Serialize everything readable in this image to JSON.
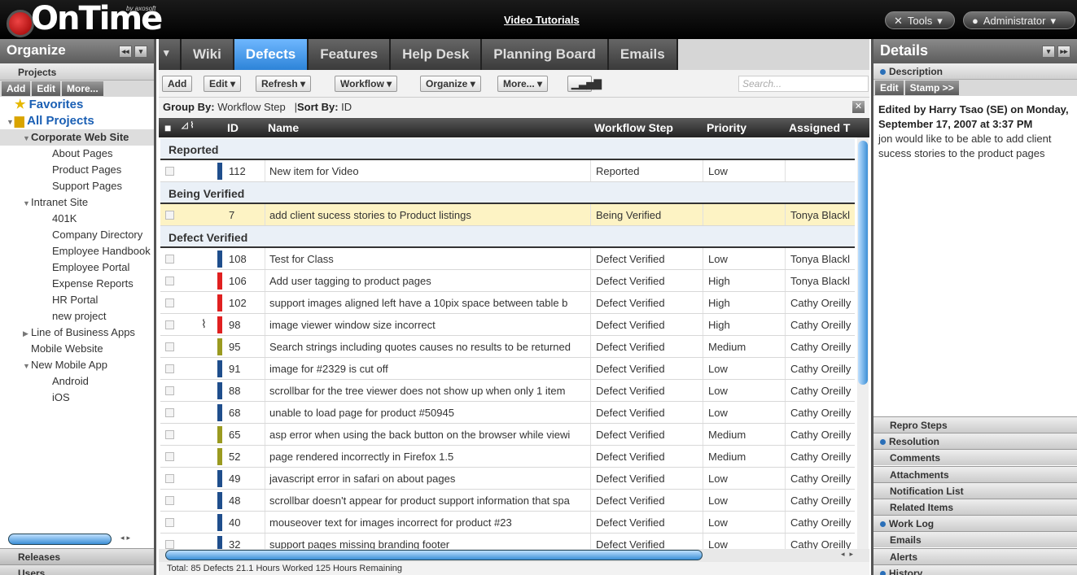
{
  "app": {
    "logo_by": "by axosoft",
    "logo_word": "OnTime",
    "video_link": "Video Tutorials",
    "tools_label": "Tools",
    "admin_label": "Administrator"
  },
  "left": {
    "title": "Organize",
    "projects_label": "Projects",
    "mini_buttons": [
      "Add",
      "Edit",
      "More..."
    ],
    "favorites": "Favorites",
    "all_projects": "All Projects",
    "tree": [
      {
        "label": "Corporate Web Site",
        "level": 1,
        "arrow": "▼"
      },
      {
        "label": "About Pages",
        "level": 2,
        "arrow": ""
      },
      {
        "label": "Product Pages",
        "level": 2,
        "arrow": ""
      },
      {
        "label": "Support Pages",
        "level": 2,
        "arrow": ""
      },
      {
        "label": "Intranet Site",
        "level": 1,
        "arrow": "▼"
      },
      {
        "label": "401K",
        "level": 2,
        "arrow": ""
      },
      {
        "label": "Company Directory",
        "level": 2,
        "arrow": ""
      },
      {
        "label": "Employee Handbook",
        "level": 2,
        "arrow": ""
      },
      {
        "label": "Employee Portal",
        "level": 2,
        "arrow": ""
      },
      {
        "label": "Expense Reports",
        "level": 2,
        "arrow": ""
      },
      {
        "label": "HR Portal",
        "level": 2,
        "arrow": ""
      },
      {
        "label": "new project",
        "level": 2,
        "arrow": ""
      },
      {
        "label": "Line of Business Apps",
        "level": 1,
        "arrow": "▶"
      },
      {
        "label": "Mobile Website",
        "level": 1,
        "arrow": ""
      },
      {
        "label": "New Mobile App",
        "level": 1,
        "arrow": "▼"
      },
      {
        "label": "Android",
        "level": 2,
        "arrow": ""
      },
      {
        "label": "iOS",
        "level": 2,
        "arrow": ""
      }
    ],
    "footer": [
      "Releases",
      "Users"
    ]
  },
  "tabs": [
    "Wiki",
    "Defects",
    "Features",
    "Help Desk",
    "Planning Board",
    "Emails"
  ],
  "toolbar": {
    "add": "Add",
    "edit": "Edit",
    "refresh": "Refresh",
    "workflow": "Workflow",
    "organize": "Organize",
    "more": "More...",
    "search_placeholder": "Search..."
  },
  "groupbar": {
    "group_label": "Group By:",
    "group_value": "Workflow Step",
    "sort_label": "Sort By:",
    "sort_value": "ID"
  },
  "grid": {
    "headers": {
      "id": "ID",
      "name": "Name",
      "workflow": "Workflow Step",
      "priority": "Priority",
      "assigned": "Assigned T"
    },
    "groups": [
      {
        "label": "Reported",
        "rows": [
          {
            "id": "112",
            "name": "New item for Video",
            "step": "Reported",
            "priority": "Low",
            "assigned": "",
            "color": "#1f4e8c",
            "clip": false
          }
        ]
      },
      {
        "label": "Being Verified",
        "rows": [
          {
            "id": "7",
            "name": "add client sucess stories to Product listings",
            "step": "Being Verified",
            "priority": "",
            "assigned": "Tonya Blackl",
            "color": "",
            "clip": false,
            "highlight": true
          }
        ]
      },
      {
        "label": "Defect Verified",
        "rows": [
          {
            "id": "108",
            "name": "Test for Class",
            "step": "Defect Verified",
            "priority": "Low",
            "assigned": "Tonya Blackl",
            "color": "#1f4e8c",
            "clip": false
          },
          {
            "id": "106",
            "name": "Add user tagging to product pages",
            "step": "Defect Verified",
            "priority": "High",
            "assigned": "Tonya Blackl",
            "color": "#e02020",
            "clip": false
          },
          {
            "id": "102",
            "name": "support images aligned left have a 10pix space between table b",
            "step": "Defect Verified",
            "priority": "High",
            "assigned": "Cathy Oreilly",
            "color": "#e02020",
            "clip": false
          },
          {
            "id": "98",
            "name": "image viewer window size incorrect",
            "step": "Defect Verified",
            "priority": "High",
            "assigned": "Cathy Oreilly",
            "color": "#e02020",
            "clip": true
          },
          {
            "id": "95",
            "name": "Search strings including quotes causes no results to be returned",
            "step": "Defect Verified",
            "priority": "Medium",
            "assigned": "Cathy Oreilly",
            "color": "#9a9a20",
            "clip": false
          },
          {
            "id": "91",
            "name": "image for #2329 is cut off",
            "step": "Defect Verified",
            "priority": "Low",
            "assigned": "Cathy Oreilly",
            "color": "#1f4e8c",
            "clip": false
          },
          {
            "id": "88",
            "name": "scrollbar for the tree viewer does not show up when only 1 item",
            "step": "Defect Verified",
            "priority": "Low",
            "assigned": "Cathy Oreilly",
            "color": "#1f4e8c",
            "clip": false
          },
          {
            "id": "68",
            "name": "unable to load page for product #50945",
            "step": "Defect Verified",
            "priority": "Low",
            "assigned": "Cathy Oreilly",
            "color": "#1f4e8c",
            "clip": false
          },
          {
            "id": "65",
            "name": "asp error when using the back button on the browser while viewi",
            "step": "Defect Verified",
            "priority": "Medium",
            "assigned": "Cathy Oreilly",
            "color": "#9a9a20",
            "clip": false
          },
          {
            "id": "52",
            "name": "page rendered incorrectly in Firefox 1.5",
            "step": "Defect Verified",
            "priority": "Medium",
            "assigned": "Cathy Oreilly",
            "color": "#9a9a20",
            "clip": false
          },
          {
            "id": "49",
            "name": "javascript error in safari on about pages",
            "step": "Defect Verified",
            "priority": "Low",
            "assigned": "Cathy Oreilly",
            "color": "#1f4e8c",
            "clip": false
          },
          {
            "id": "48",
            "name": "scrollbar doesn't appear for product support information that spa",
            "step": "Defect Verified",
            "priority": "Low",
            "assigned": "Cathy Oreilly",
            "color": "#1f4e8c",
            "clip": false
          },
          {
            "id": "40",
            "name": "mouseover text for images incorrect for product #23",
            "step": "Defect Verified",
            "priority": "Low",
            "assigned": "Cathy Oreilly",
            "color": "#1f4e8c",
            "clip": false
          },
          {
            "id": "32",
            "name": "support pages missing branding footer",
            "step": "Defect Verified",
            "priority": "Low",
            "assigned": "Cathy Oreilly",
            "color": "#1f4e8c",
            "clip": false
          }
        ]
      }
    ]
  },
  "status": "Total: 85 Defects   21.1 Hours Worked   125 Hours Remaining",
  "right": {
    "title": "Details",
    "description_label": "Description",
    "edit": "Edit",
    "stamp": "Stamp >>",
    "edited_by": "Edited by Harry Tsao (SE) on Monday, September 17, 2007 at 3:37 PM",
    "text": "jon would like to be able to add client sucess stories to the product pages",
    "sections": [
      {
        "label": "Repro Steps",
        "dot": false
      },
      {
        "label": "Resolution",
        "dot": true
      },
      {
        "label": "Comments",
        "dot": false
      },
      {
        "label": "Attachments",
        "dot": false
      },
      {
        "label": "Notification List",
        "dot": false
      },
      {
        "label": "Related Items",
        "dot": false
      },
      {
        "label": "Work Log",
        "dot": true
      },
      {
        "label": "Emails",
        "dot": false
      },
      {
        "label": "Alerts",
        "dot": false
      },
      {
        "label": "History",
        "dot": true
      }
    ]
  },
  "colors": {
    "active_tab": "#2d84d8",
    "high": "#e02020",
    "medium": "#9a9a20",
    "low": "#1f4e8c"
  }
}
